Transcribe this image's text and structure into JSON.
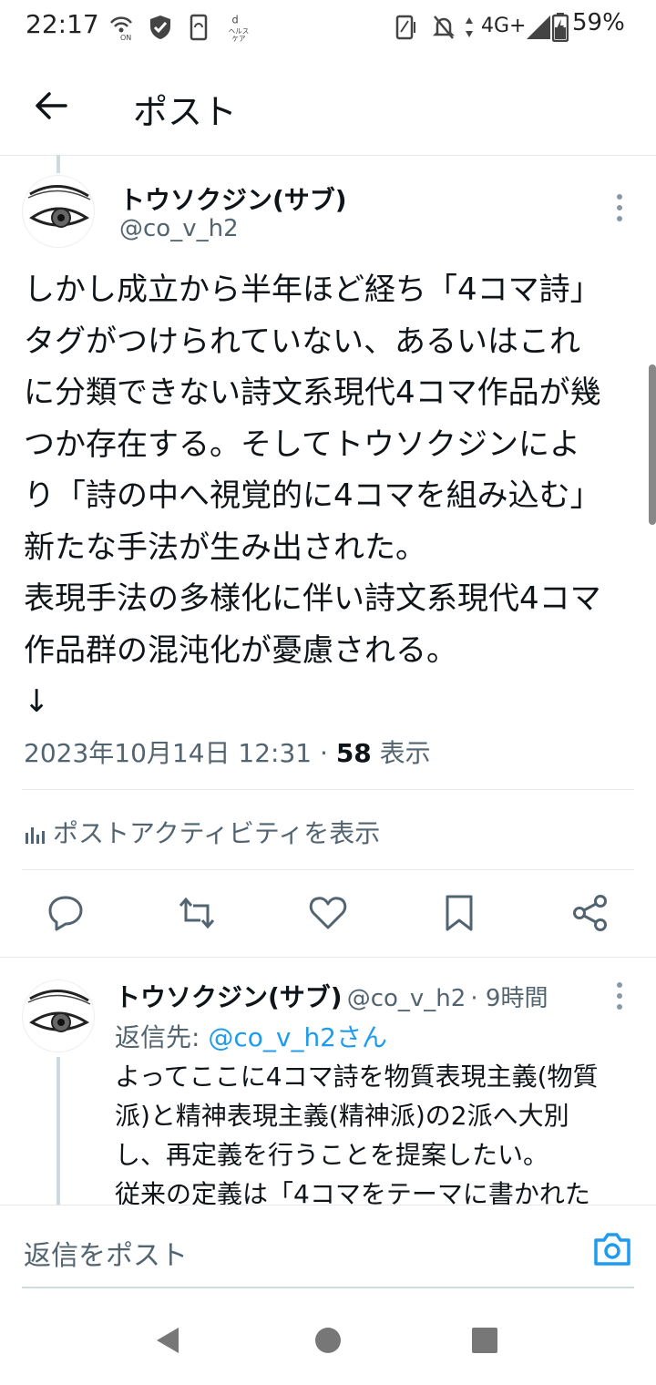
{
  "status_bar": {
    "time": "22:17",
    "network": "4G+",
    "battery": "59%"
  },
  "header": {
    "title": "ポスト"
  },
  "tweet": {
    "author_name": "トウソクジン(サブ)",
    "author_handle": "@co_v_h2",
    "text": "しかし成立から半年ほど経ち「4コマ詩」\nタグがつけられていない、あるいはこれ\nに分類できない詩文系現代4コマ作品が幾\nつか存在する。そしてトウソクジンによ\nり「詩の中へ視覚的に4コマを組み込む」\n新たな手法が生み出された。\n表現手法の多様化に伴い詩文系現代4コマ\n作品群の混沌化が憂慮される。\n↓",
    "date": "2023年10月14日 12:31 · ",
    "views_count": "58",
    "views_label": " 表示",
    "activity_label": "ポストアクティビティを表示"
  },
  "reply": {
    "author_name": "トウソクジン(サブ)",
    "author_handle": "@co_v_h2",
    "time": "· 9時間",
    "reply_to_label": "返信先: ",
    "reply_to_link": "@co_v_h2さん",
    "text": "よってここに4コマ詩を物質表現主義(物質\n派)と精神表現主義(精神派)の2派へ大別\nし、再定義を行うことを提案したい。\n従来の定義は「4コマをテーマに書かれた"
  },
  "compose": {
    "placeholder": "返信をポスト"
  },
  "icons": [
    "back-arrow-icon",
    "more-icon",
    "reply-icon",
    "repost-icon",
    "like-icon",
    "bookmark-icon",
    "share-icon",
    "analytics-icon",
    "camera-icon"
  ],
  "colors": {
    "accent": "#1d9bf0",
    "text": "#0f1419",
    "secondary": "#536471"
  }
}
